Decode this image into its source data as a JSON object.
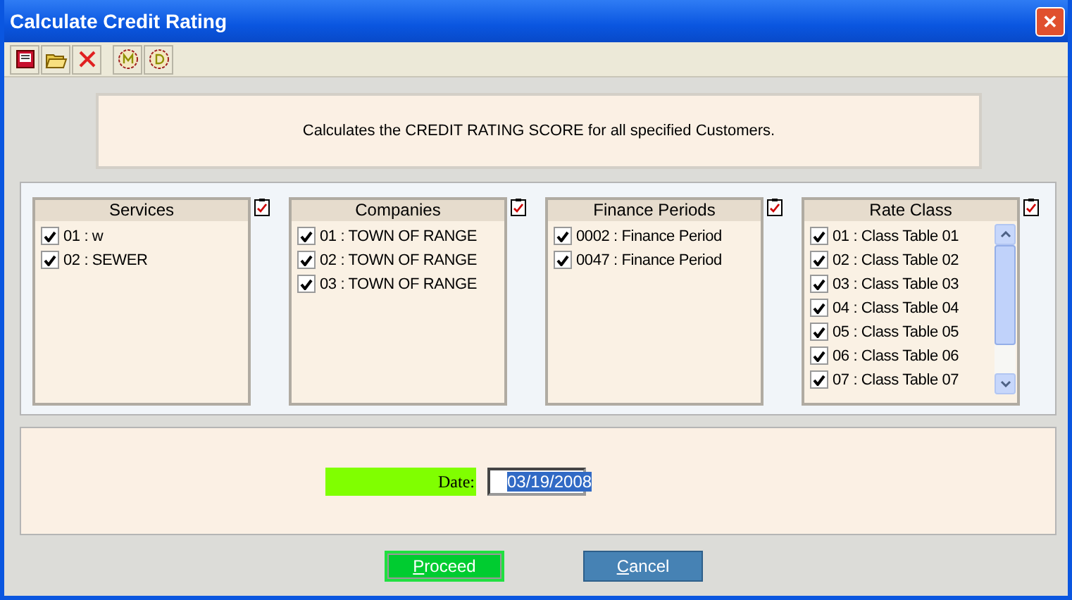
{
  "window": {
    "title": "Calculate Credit Rating",
    "close": "✕"
  },
  "description": "Calculates the CREDIT RATING SCORE for all specified Customers.",
  "lists": [
    {
      "title": "Services",
      "items": [
        {
          "label": "01 : w",
          "checked": true
        },
        {
          "label": "02 : SEWER",
          "checked": true
        }
      ]
    },
    {
      "title": "Companies",
      "items": [
        {
          "label": "01 : TOWN OF RANGE",
          "checked": true
        },
        {
          "label": "02 : TOWN OF RANGE",
          "checked": true
        },
        {
          "label": "03 : TOWN OF RANGE",
          "checked": true
        }
      ]
    },
    {
      "title": "Finance Periods",
      "items": [
        {
          "label": "0002 : Finance Period",
          "checked": true
        },
        {
          "label": "0047 : Finance Period",
          "checked": true
        }
      ]
    },
    {
      "title": "Rate Class",
      "scrollable": true,
      "items": [
        {
          "label": "01 : Class Table 01",
          "checked": true
        },
        {
          "label": "02 : Class Table 02",
          "checked": true
        },
        {
          "label": "03 : Class Table 03",
          "checked": true
        },
        {
          "label": "04 : Class Table 04",
          "checked": true
        },
        {
          "label": "05 : Class Table 05",
          "checked": true
        },
        {
          "label": "06 : Class Table 06",
          "checked": true
        },
        {
          "label": "07 : Class Table 07",
          "checked": true
        }
      ]
    }
  ],
  "date": {
    "label": "Date:",
    "value": "03/19/2008"
  },
  "buttons": [
    {
      "label": "Proceed",
      "kind": "primary"
    },
    {
      "label": "Cancel",
      "kind": "secondary"
    }
  ]
}
